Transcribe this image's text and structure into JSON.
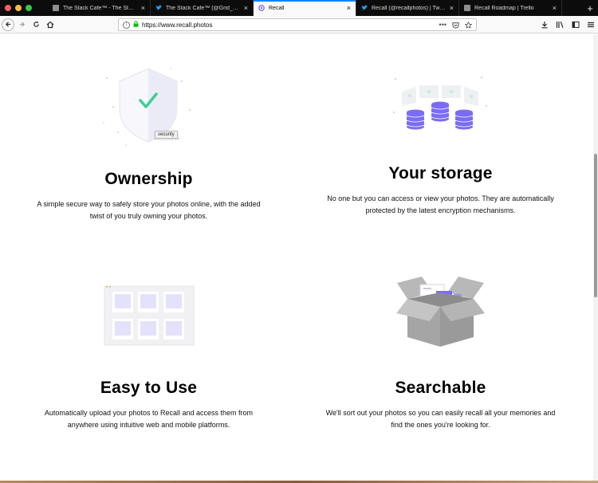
{
  "browser": {
    "tabs": [
      {
        "title": "The Stack Cafe™ - The Stack",
        "favicon": "stack-favicon",
        "active": false
      },
      {
        "title": "The Stack Cafe™ (@Grid_dev",
        "favicon": "twitter-favicon",
        "active": false
      },
      {
        "title": "Recall",
        "favicon": "recall-favicon",
        "active": true
      },
      {
        "title": "Recall (@recallphotos) | Twitter",
        "favicon": "twitter-favicon",
        "active": false
      },
      {
        "title": "Recall Roadmap | Trello",
        "favicon": "trello-favicon",
        "active": false
      }
    ],
    "new_tab_label": "+",
    "url": "https://www.recall.photos",
    "url_actions": "•••",
    "colors": {
      "active_tab_accent": "#0a84ff",
      "lock_green": "#12bc00"
    }
  },
  "features": {
    "ownership": {
      "title": "Ownership",
      "description": "A simple secure way to safely store your photos online, with the added twist of you truly owning your photos.",
      "tooltip": "security",
      "icon": "shield-check-icon"
    },
    "storage": {
      "title": "Your storage",
      "description": "No one but you can access or view your photos. They are automatically protected by the latest encryption mechanisms.",
      "icon": "coin-stacks-icon"
    },
    "easy": {
      "title": "Easy to Use",
      "description": "Automatically upload your photos to Recall and access them from anywhere using intuitive web and mobile platforms.",
      "icon": "photo-grid-icon"
    },
    "searchable": {
      "title": "Searchable",
      "description": "We'll sort out your photos so you can easily recall all your memories and find the ones you're looking for.",
      "icon": "open-box-icon"
    }
  },
  "accent_colors": {
    "purple": "#7b6cf6",
    "teal": "#3ecf8e",
    "grey_box": "#a5a5a5"
  }
}
